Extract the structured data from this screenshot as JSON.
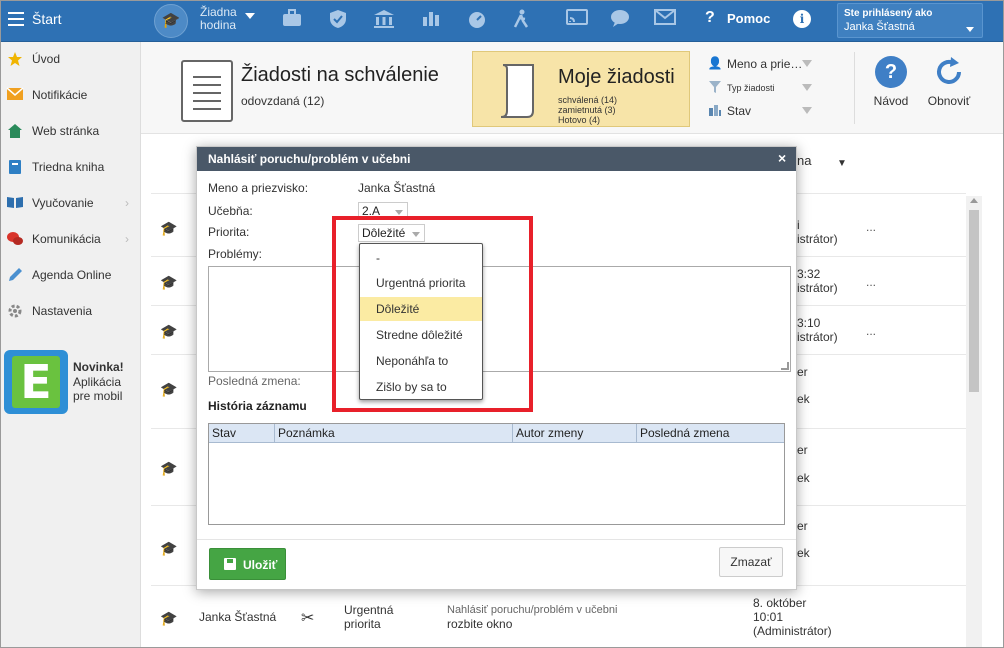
{
  "topbar": {
    "start_label": "Štart",
    "lesson_label": "Žiadna hodina",
    "help_label": "Pomoc",
    "info_label": "i",
    "user_label": "Ste prihlásený ako",
    "user_name": "Janka Šťastná"
  },
  "sidebar": {
    "items": [
      {
        "label": "Úvod",
        "icon": "star-icon"
      },
      {
        "label": "Notifikácie",
        "icon": "envelope-icon"
      },
      {
        "label": "Web stránka",
        "icon": "house-icon"
      },
      {
        "label": "Triedna kniha",
        "icon": "book-icon"
      },
      {
        "label": "Vyučovanie",
        "icon": "open-book-icon"
      },
      {
        "label": "Komunikácia",
        "icon": "chat-bubbles-icon"
      },
      {
        "label": "Agenda Online",
        "icon": "pen-icon"
      },
      {
        "label": "Nastavenia",
        "icon": "gear-icon"
      }
    ],
    "promo_title": "Novinka!",
    "promo_text": "Aplikácia pre mobil"
  },
  "toolbar": {
    "approval_title": "Žiadosti na schválenie",
    "approval_sub": "odovzdaná (12)",
    "my_title": "Moje žiadosti",
    "my_line1": "schválená (14)",
    "my_line2": "zamietnutá (3)",
    "my_line3": "Hotovo (4)",
    "filter_name": "Meno a prie…",
    "filter_type": "Typ žiadosti",
    "filter_state": "Stav",
    "help_btn": "Návod",
    "refresh_btn": "Obnoviť"
  },
  "background": {
    "header_partial": "na",
    "rows": [
      {
        "t1": "i",
        "t2": "istrátor)"
      },
      {
        "t1": "3:32",
        "t2": "istrátor)"
      },
      {
        "t1": "3:10",
        "t2": "istrátor)"
      },
      {
        "t1": "er",
        "t2": "ek"
      },
      {
        "t1": "er",
        "t2": "ek"
      },
      {
        "t1": "er",
        "t2": "ek"
      }
    ],
    "last_row": {
      "name": "Janka Šťastná",
      "priority_l1": "Urgentná",
      "priority_l2": "priorita",
      "type": "Nahlásiť poruchu/problém v učebni",
      "note": "rozbite okno",
      "date_l1": "8. október",
      "date_l2": "10:01",
      "date_l3": "(Administrátor)"
    },
    "dots": "..."
  },
  "modal": {
    "title": "Nahlásiť poruchu/problém v učebni",
    "close": "×",
    "name_label": "Meno a priezvisko:",
    "name_value": "Janka Šťastná",
    "room_label": "Učebňa:",
    "room_value": "2.A",
    "priority_label": "Priorita:",
    "priority_value": "Dôležité",
    "problems_label": "Problémy:",
    "last_change_label": "Posledná zmena:",
    "history_title": "História záznamu",
    "history_cols": [
      "Stav",
      "Poznámka",
      "Autor zmeny",
      "Posledná zmena"
    ],
    "save_label": "Uložiť",
    "delete_label": "Zmazať"
  },
  "priority_options": [
    "-",
    "Urgentná priorita",
    "Dôležité",
    "Stredne dôležité",
    "Neponáhľa to",
    "Zišlo by sa to"
  ],
  "colors": {
    "topbar": "#2e71b4",
    "highlight": "#e8202a",
    "selected_option": "#fbeba3",
    "save_button": "#45a544",
    "modal_header": "#4a5868"
  }
}
